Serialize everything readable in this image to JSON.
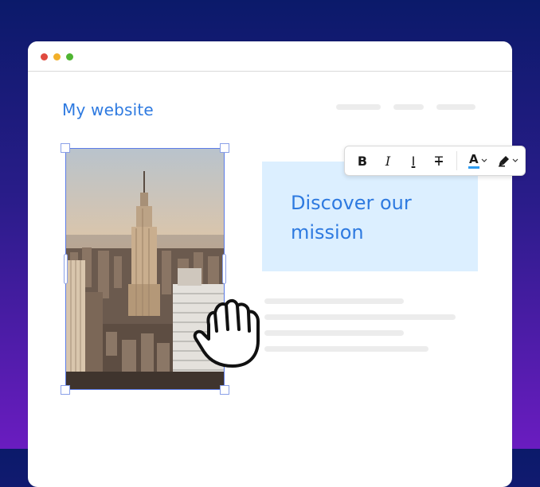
{
  "window": {
    "controls": [
      "close",
      "minimize",
      "maximize"
    ],
    "colors": {
      "close": "#e04a3f",
      "minimize": "#f2b02a",
      "maximize": "#4fb532"
    }
  },
  "site": {
    "title": "My website",
    "accent": "#2e7ae0"
  },
  "hero": {
    "heading": "Discover our mission",
    "background": "#dcefff"
  },
  "toolbar": {
    "bold": "B",
    "italic": "I",
    "underline": "I",
    "strikethrough": "T",
    "text_color": "A",
    "text_color_value": "#2e9bf0",
    "highlight_icon": "highlighter-icon"
  },
  "image": {
    "icon": "city-skyline-photo",
    "selected": true
  },
  "cursor": {
    "icon": "grab-hand-icon"
  }
}
